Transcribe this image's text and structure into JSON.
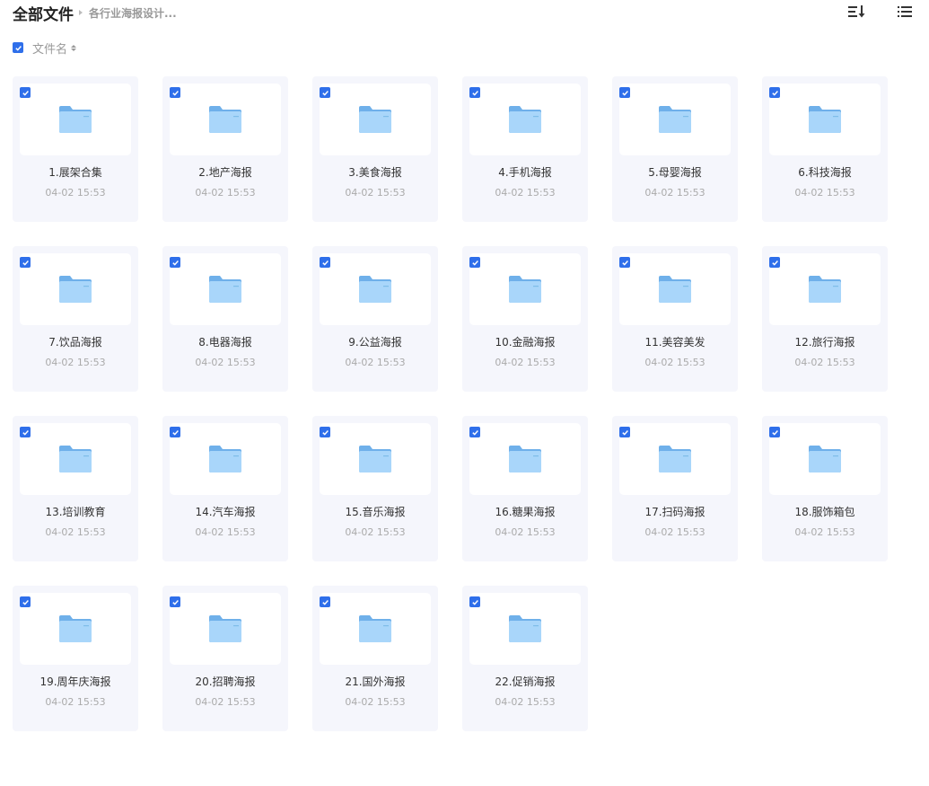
{
  "breadcrumb": {
    "root": "全部文件",
    "current": "各行业海报设计..."
  },
  "toolbar": {
    "sort_icon": "sort-icon",
    "view_icon": "list-view-icon"
  },
  "sortbar": {
    "label": "文件名"
  },
  "colors": {
    "accent": "#2f6fea",
    "card_bg": "#f5f6fc",
    "folder_back": "#6fb0ea",
    "folder_front": "#a9d6fa"
  },
  "files": [
    {
      "name": "1.展架合集",
      "date": "04-02 15:53",
      "checked": true
    },
    {
      "name": "2.地产海报",
      "date": "04-02 15:53",
      "checked": true
    },
    {
      "name": "3.美食海报",
      "date": "04-02 15:53",
      "checked": true
    },
    {
      "name": "4.手机海报",
      "date": "04-02 15:53",
      "checked": true
    },
    {
      "name": "5.母婴海报",
      "date": "04-02 15:53",
      "checked": true
    },
    {
      "name": "6.科技海报",
      "date": "04-02 15:53",
      "checked": true
    },
    {
      "name": "7.饮品海报",
      "date": "04-02 15:53",
      "checked": true
    },
    {
      "name": "8.电器海报",
      "date": "04-02 15:53",
      "checked": true
    },
    {
      "name": "9.公益海报",
      "date": "04-02 15:53",
      "checked": true
    },
    {
      "name": "10.金融海报",
      "date": "04-02 15:53",
      "checked": true
    },
    {
      "name": "11.美容美发",
      "date": "04-02 15:53",
      "checked": true
    },
    {
      "name": "12.旅行海报",
      "date": "04-02 15:53",
      "checked": true
    },
    {
      "name": "13.培训教育",
      "date": "04-02 15:53",
      "checked": true
    },
    {
      "name": "14.汽车海报",
      "date": "04-02 15:53",
      "checked": true
    },
    {
      "name": "15.音乐海报",
      "date": "04-02 15:53",
      "checked": true
    },
    {
      "name": "16.糖果海报",
      "date": "04-02 15:53",
      "checked": true
    },
    {
      "name": "17.扫码海报",
      "date": "04-02 15:53",
      "checked": true
    },
    {
      "name": "18.服饰箱包",
      "date": "04-02 15:53",
      "checked": true
    },
    {
      "name": "19.周年庆海报",
      "date": "04-02 15:53",
      "checked": true
    },
    {
      "name": "20.招聘海报",
      "date": "04-02 15:53",
      "checked": true
    },
    {
      "name": "21.国外海报",
      "date": "04-02 15:53",
      "checked": true
    },
    {
      "name": "22.促销海报",
      "date": "04-02 15:53",
      "checked": true
    }
  ]
}
